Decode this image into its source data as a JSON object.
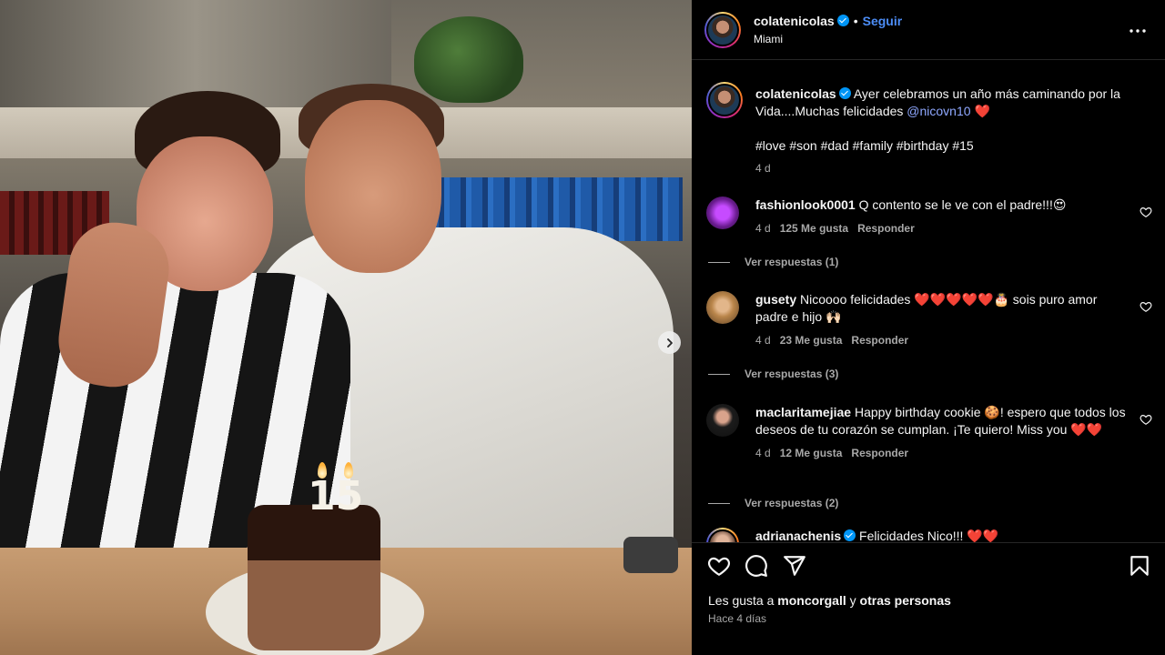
{
  "header": {
    "username": "colatenicolas",
    "separator": "•",
    "follow_label": "Seguir",
    "location": "Miami",
    "more_icon": "more-horizontal-icon"
  },
  "photo": {
    "candle_text": "15",
    "carousel_next_icon": "chevron-right-icon"
  },
  "caption": {
    "username": "colatenicolas",
    "text": "Ayer celebramos un año más caminando por la Vida....Muchas felicidades",
    "mention": "@nicovn10",
    "emoji": "❤️",
    "hashtags": "#love #son #dad #family #birthday #15",
    "time": "4 d"
  },
  "comments": [
    {
      "username": "fashionlook0001",
      "text": "Q contento se le ve con el padre!!!😍",
      "time": "4 d",
      "likes": "125 Me gusta",
      "reply_label": "Responder",
      "view_replies": "Ver respuestas (1)"
    },
    {
      "username": "gusety",
      "text": "Nicoooo felicidades ❤️❤️❤️❤️❤️🎂 sois puro amor padre e hijo 🙌🏻",
      "time": "4 d",
      "likes": "23 Me gusta",
      "reply_label": "Responder",
      "view_replies": "Ver respuestas (3)"
    },
    {
      "username": "maclaritamejiae",
      "text": "Happy birthday cookie 🍪! espero que todos los deseos de tu corazón se cumplan. ¡Te quiero! Miss you ❤️❤️",
      "time": "4 d",
      "likes": "12 Me gusta",
      "reply_label": "Responder",
      "view_replies": "Ver respuestas (2)"
    },
    {
      "username": "adrianachenis",
      "text": "Felicidades Nico!!! ❤️❤️"
    }
  ],
  "actions": {
    "like_icon": "heart-icon",
    "comment_icon": "comment-icon",
    "share_icon": "share-icon",
    "save_icon": "bookmark-icon",
    "likes_prefix": "Les gusta a",
    "likes_user": "moncorgall",
    "likes_mid": "y",
    "likes_others": "otras personas",
    "date": "Hace 4 días"
  },
  "colors": {
    "background": "#000000",
    "accent_link": "#4c8df6",
    "hashtag": "#8fa8ff",
    "verified": "#0095f6",
    "muted": "#a8a8a8"
  }
}
